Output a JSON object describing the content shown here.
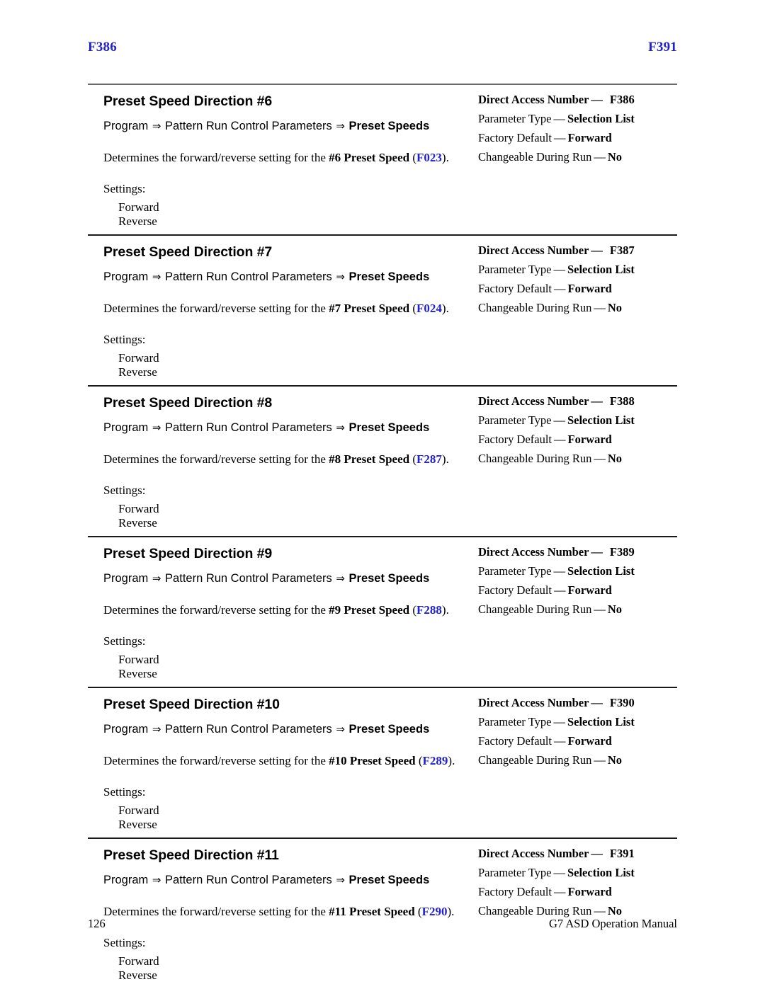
{
  "header": {
    "left_folio": "F386",
    "right_folio": "F391"
  },
  "sections": [
    {
      "title": "Preset Speed Direction #6",
      "breadcrumb": {
        "part1": "Program",
        "arrow1": "⇒",
        "part2": "Pattern Run Control Parameters",
        "arrow2": "⇒",
        "leaf": "Preset Speeds"
      },
      "description": {
        "lead": "Determines the forward/reverse setting for the ",
        "bold": "#6 Preset Speed",
        "mid": " (",
        "code": "F023",
        "tail": ")."
      },
      "settings_label": "Settings:",
      "settings": [
        "Forward",
        "Reverse"
      ],
      "specs": [
        {
          "label": "Direct Access Number",
          "dash": "—",
          "value": "F386",
          "all_bold": true
        },
        {
          "label": "Parameter Type",
          "dash": "—",
          "value": "Selection List",
          "all_bold": false
        },
        {
          "label": "Factory Default",
          "dash": "—",
          "value": "Forward",
          "all_bold": false
        },
        {
          "label": "Changeable During Run",
          "dash": "—",
          "value": "No",
          "all_bold": false
        }
      ]
    },
    {
      "title": "Preset Speed Direction #7",
      "breadcrumb": {
        "part1": "Program",
        "arrow1": "⇒",
        "part2": "Pattern Run Control Parameters",
        "arrow2": "⇒",
        "leaf": "Preset Speeds"
      },
      "description": {
        "lead": "Determines the forward/reverse setting for the ",
        "bold": "#7 Preset Speed",
        "mid": " (",
        "code": "F024",
        "tail": ")."
      },
      "settings_label": "Settings:",
      "settings": [
        "Forward",
        "Reverse"
      ],
      "specs": [
        {
          "label": "Direct Access Number",
          "dash": "—",
          "value": "F387",
          "all_bold": true
        },
        {
          "label": "Parameter Type",
          "dash": "—",
          "value": "Selection List",
          "all_bold": false
        },
        {
          "label": "Factory Default",
          "dash": "—",
          "value": "Forward",
          "all_bold": false
        },
        {
          "label": "Changeable During Run",
          "dash": "—",
          "value": "No",
          "all_bold": false
        }
      ]
    },
    {
      "title": "Preset Speed Direction #8",
      "breadcrumb": {
        "part1": "Program",
        "arrow1": "⇒",
        "part2": "Pattern Run Control Parameters",
        "arrow2": "⇒",
        "leaf": "Preset Speeds"
      },
      "description": {
        "lead": "Determines the forward/reverse setting for the ",
        "bold": "#8 Preset Speed",
        "mid": " (",
        "code": "F287",
        "tail": ")."
      },
      "settings_label": "Settings:",
      "settings": [
        "Forward",
        "Reverse"
      ],
      "specs": [
        {
          "label": "Direct Access Number",
          "dash": "—",
          "value": "F388",
          "all_bold": true
        },
        {
          "label": "Parameter Type",
          "dash": "—",
          "value": "Selection List",
          "all_bold": false
        },
        {
          "label": "Factory Default",
          "dash": "—",
          "value": "Forward",
          "all_bold": false
        },
        {
          "label": "Changeable During Run",
          "dash": "—",
          "value": "No",
          "all_bold": false
        }
      ]
    },
    {
      "title": "Preset Speed Direction #9",
      "breadcrumb": {
        "part1": "Program",
        "arrow1": "⇒",
        "part2": "Pattern Run Control Parameters",
        "arrow2": "⇒",
        "leaf": "Preset Speeds"
      },
      "description": {
        "lead": "Determines the forward/reverse setting for the ",
        "bold": "#9 Preset Speed",
        "mid": " (",
        "code": "F288",
        "tail": ")."
      },
      "settings_label": "Settings:",
      "settings": [
        "Forward",
        "Reverse"
      ],
      "specs": [
        {
          "label": "Direct Access Number",
          "dash": "—",
          "value": "F389",
          "all_bold": true
        },
        {
          "label": "Parameter Type",
          "dash": "—",
          "value": "Selection List",
          "all_bold": false
        },
        {
          "label": "Factory Default",
          "dash": "—",
          "value": "Forward",
          "all_bold": false
        },
        {
          "label": "Changeable During Run",
          "dash": "—",
          "value": "No",
          "all_bold": false
        }
      ]
    },
    {
      "title": "Preset Speed Direction #10",
      "breadcrumb": {
        "part1": "Program",
        "arrow1": "⇒",
        "part2": "Pattern Run Control Parameters",
        "arrow2": "⇒",
        "leaf": "Preset Speeds"
      },
      "description": {
        "lead": "Determines the forward/reverse setting for the ",
        "bold": "#10 Preset Speed",
        "mid": " (",
        "code": "F289",
        "tail": ")."
      },
      "settings_label": "Settings:",
      "settings": [
        "Forward",
        "Reverse"
      ],
      "specs": [
        {
          "label": "Direct Access Number",
          "dash": "—",
          "value": "F390",
          "all_bold": true
        },
        {
          "label": "Parameter Type",
          "dash": "—",
          "value": "Selection List",
          "all_bold": false
        },
        {
          "label": "Factory Default",
          "dash": "—",
          "value": "Forward",
          "all_bold": false
        },
        {
          "label": "Changeable During Run",
          "dash": "—",
          "value": "No",
          "all_bold": false
        }
      ]
    },
    {
      "title": "Preset Speed Direction #11",
      "breadcrumb": {
        "part1": "Program",
        "arrow1": "⇒",
        "part2": "Pattern Run Control Parameters",
        "arrow2": "⇒",
        "leaf": "Preset Speeds"
      },
      "description": {
        "lead": "Determines the forward/reverse setting for the ",
        "bold": "#11 Preset Speed",
        "mid": " (",
        "code": "F290",
        "tail": ")."
      },
      "settings_label": "Settings:",
      "settings": [
        "Forward",
        "Reverse"
      ],
      "specs": [
        {
          "label": "Direct Access Number",
          "dash": "—",
          "value": "F391",
          "all_bold": true
        },
        {
          "label": "Parameter Type",
          "dash": "—",
          "value": "Selection List",
          "all_bold": false
        },
        {
          "label": "Factory Default",
          "dash": "—",
          "value": "Forward",
          "all_bold": false
        },
        {
          "label": "Changeable During Run",
          "dash": "—",
          "value": "No",
          "all_bold": false
        }
      ]
    }
  ],
  "footer": {
    "page_number": "126",
    "manual_title": "G7 ASD Operation Manual"
  },
  "colors": {
    "link_blue": "#2222cc",
    "rule_gray": "#6a6a6a",
    "rule_dark": "#1a1a1a",
    "text": "#000000"
  }
}
